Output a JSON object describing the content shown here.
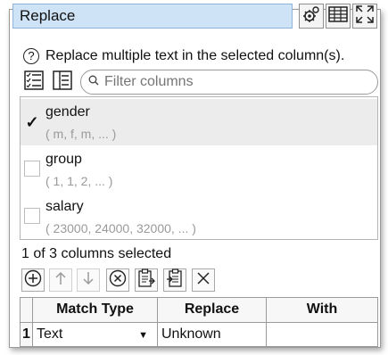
{
  "header": {
    "title": "Replace",
    "buttons": [
      "settings-icon",
      "table-icon",
      "expand-icon"
    ]
  },
  "description": "Replace multiple text in the selected column(s).",
  "filter": {
    "placeholder": "Filter columns"
  },
  "columns": [
    {
      "name": "gender",
      "values": "( m, f, m, ... )",
      "checked": true
    },
    {
      "name": "group",
      "values": "( 1, 1, 2, ... )",
      "checked": false
    },
    {
      "name": "salary",
      "values": "( 23000, 24000, 32000, ... )",
      "checked": false
    }
  ],
  "status": "1 of 3 columns selected",
  "toolbar": [
    "add-icon",
    "up-arrow-icon",
    "down-arrow-icon",
    "remove-icon",
    "paste-icon",
    "import-icon",
    "clear-icon"
  ],
  "grid": {
    "headers": [
      "Match Type",
      "Replace",
      "With"
    ],
    "rows": [
      {
        "num": "1",
        "match_type": "Text",
        "replace": "Unknown",
        "with": ""
      }
    ]
  },
  "colors": {
    "title_bg": "#cfe3f6",
    "selected_row": "#ececec"
  }
}
